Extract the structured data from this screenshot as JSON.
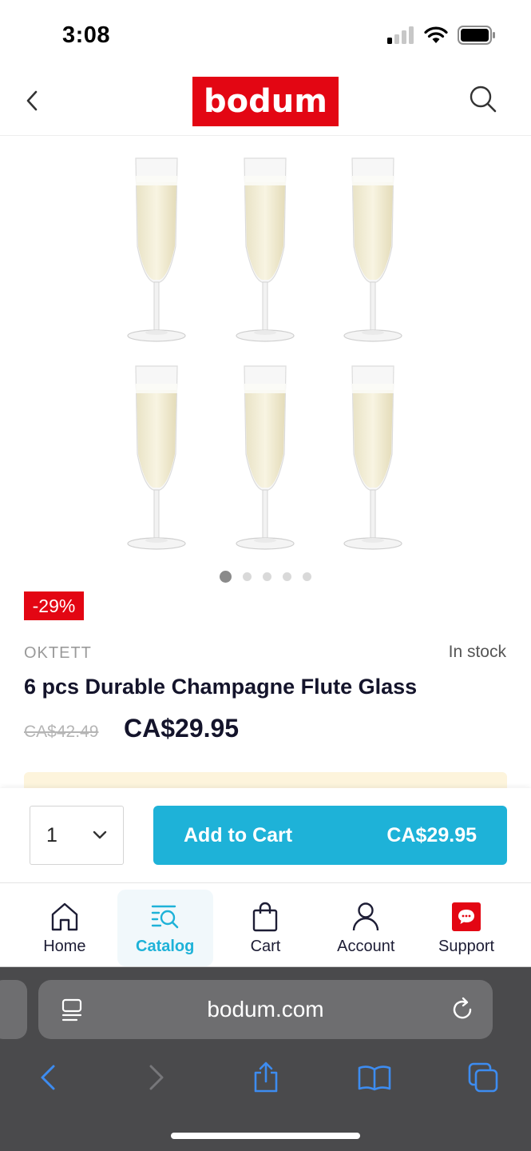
{
  "status_bar": {
    "time": "3:08"
  },
  "header": {
    "logo_text": "bodum"
  },
  "product": {
    "discount": "-29%",
    "collection": "OKTETT",
    "stock": "In stock",
    "title": "6 pcs Durable Champagne Flute Glass",
    "old_price": "CA$42.49",
    "price": "CA$29.95",
    "gallery_count": 5,
    "gallery_active": 1
  },
  "cart": {
    "quantity": "1",
    "add_label": "Add to Cart",
    "add_price": "CA$29.95"
  },
  "tabs": [
    {
      "label": "Home",
      "icon": "home-icon"
    },
    {
      "label": "Catalog",
      "icon": "catalog-icon",
      "active": true
    },
    {
      "label": "Cart",
      "icon": "bag-icon"
    },
    {
      "label": "Account",
      "icon": "user-icon"
    },
    {
      "label": "Support",
      "icon": "chat-icon"
    }
  ],
  "browser": {
    "url": "bodum.com"
  },
  "colors": {
    "brand_red": "#e30613",
    "accent": "#1eb2d8",
    "promo": "#fdf4dc"
  }
}
